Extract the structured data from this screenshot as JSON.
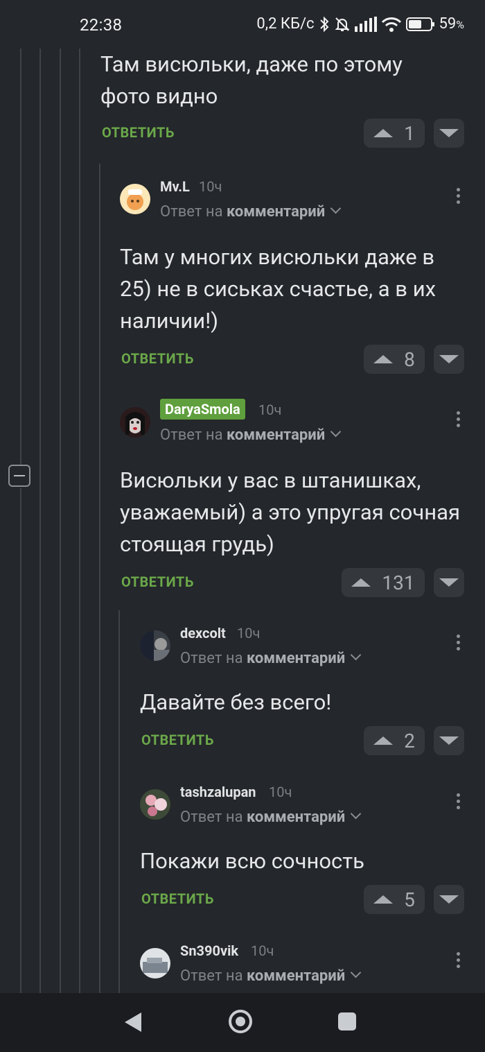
{
  "status": {
    "time": "22:38",
    "net_speed": "0,2 КБ/с",
    "battery_pct": "59",
    "battery_unit": "%",
    "icons": [
      "bluetooth-icon",
      "bell-off-icon",
      "signal-icon",
      "wifi-icon",
      "battery-icon"
    ]
  },
  "labels": {
    "reply": "ОТВЕТИТЬ",
    "reply_to": "Ответ на",
    "reply_target": "комментарий"
  },
  "top": {
    "text": "Там висюльки, даже по этому фото видно",
    "votes": "1"
  },
  "comments": [
    {
      "user": "Mv.L",
      "time": "10ч",
      "text": "Там у многих висюльки даже в 25) не в сиськах счастье, а в их наличии!)",
      "votes": "8"
    },
    {
      "user": "DaryaSmola",
      "time": "10ч",
      "text": "Висюльки у вас в штанишках, уважаемый) а это упругая сочная стоящая грудь)",
      "votes": "131"
    },
    {
      "user": "dexcolt",
      "time": "10ч",
      "text": "Давайте без всего!",
      "votes": "2"
    },
    {
      "user": "tashzalupan",
      "time": "10ч",
      "text": "Покажи всю сочность",
      "votes": "5"
    },
    {
      "user": "Sn390vik",
      "time": "10ч"
    }
  ],
  "colors": {
    "accent_green": "#6ba84a",
    "badge_green": "#5f9f3d",
    "bg": "#24272b"
  }
}
